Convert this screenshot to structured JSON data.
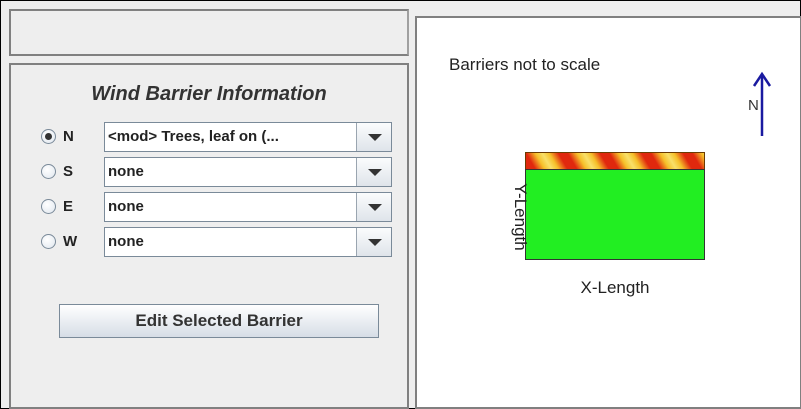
{
  "wind_barrier": {
    "title": "Wind Barrier Information",
    "rows": [
      {
        "direction": "N",
        "selected": true,
        "value": "<mod> Trees, leaf on (..."
      },
      {
        "direction": "S",
        "selected": false,
        "value": "none"
      },
      {
        "direction": "E",
        "selected": false,
        "value": "none"
      },
      {
        "direction": "W",
        "selected": false,
        "value": "none"
      }
    ],
    "edit_button": "Edit Selected Barrier"
  },
  "visualization": {
    "scale_note": "Barriers not to scale",
    "north_label": "N",
    "x_label": "X-Length",
    "y_label": "Y-Length",
    "field_color": "#22ee22",
    "barrier_colors": [
      "#e0280e",
      "#f6c02a"
    ],
    "north_arrow_color": "#1a1aa0"
  }
}
